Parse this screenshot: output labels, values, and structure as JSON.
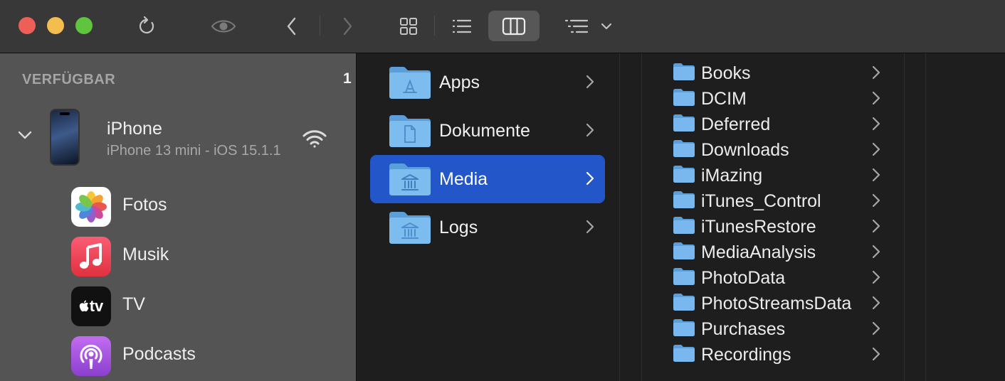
{
  "toolbar": {
    "traffic_lights": [
      {
        "name": "close",
        "color": "#ee5f57"
      },
      {
        "name": "minimize",
        "color": "#f4bd4f"
      },
      {
        "name": "zoom",
        "color": "#5fc53f"
      }
    ],
    "icons": {
      "refresh": "refresh-icon",
      "preview": "eye-icon",
      "back": "chevron-left-icon",
      "forward": "chevron-right-icon",
      "icon_view": "grid-view-icon",
      "list_view": "list-view-icon",
      "column_view": "column-view-icon",
      "group": "group-by-icon"
    },
    "selected_view": "column_view"
  },
  "sidebar": {
    "section_title": "VERFÜGBAR",
    "count": "1",
    "device": {
      "name": "iPhone",
      "subtitle": "iPhone 13 mini - iOS 15.1.1",
      "connection_icon": "wifi-icon"
    },
    "apps": [
      {
        "label": "Fotos",
        "icon": "photos-icon"
      },
      {
        "label": "Musik",
        "icon": "music-icon"
      },
      {
        "label": "TV",
        "icon": "tv-icon",
        "icon_text": "tv"
      },
      {
        "label": "Podcasts",
        "icon": "podcasts-icon"
      }
    ]
  },
  "column1": {
    "items": [
      {
        "label": "Apps",
        "glyph": "apps"
      },
      {
        "label": "Dokumente",
        "glyph": "document"
      },
      {
        "label": "Media",
        "glyph": "library"
      },
      {
        "label": "Logs",
        "glyph": "library"
      }
    ],
    "selected_index": 2,
    "selection_color": "#2356c9"
  },
  "column2": {
    "items": [
      {
        "label": "Books"
      },
      {
        "label": "DCIM"
      },
      {
        "label": "Deferred"
      },
      {
        "label": "Downloads"
      },
      {
        "label": "iMazing"
      },
      {
        "label": "iTunes_Control"
      },
      {
        "label": "iTunesRestore"
      },
      {
        "label": "MediaAnalysis"
      },
      {
        "label": "PhotoData"
      },
      {
        "label": "PhotoStreamsData"
      },
      {
        "label": "Purchases"
      },
      {
        "label": "Recordings"
      }
    ]
  },
  "colors": {
    "folder": "#6fb3ec",
    "folder_dark": "#5a9fd9",
    "sidebar_bg": "#545454",
    "toolbar_bg": "#383838",
    "content_bg": "#1e1e1e"
  }
}
